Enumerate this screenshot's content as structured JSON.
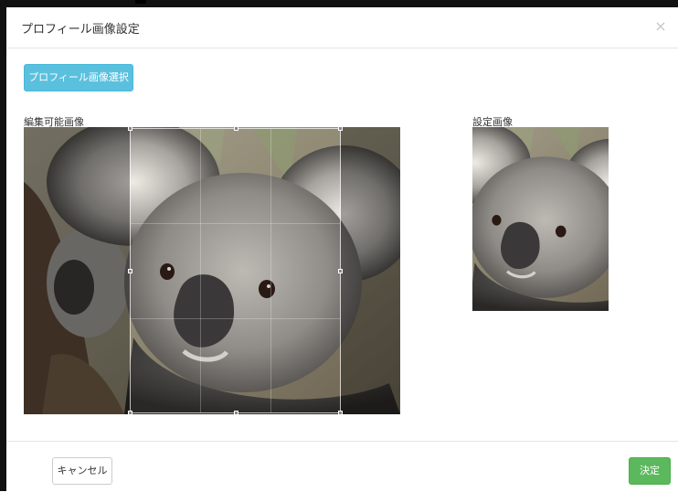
{
  "modal": {
    "title": "プロフィール画像設定",
    "close_glyph": "×"
  },
  "toolbar": {
    "select_image_label": "プロフィール画像選択"
  },
  "editor": {
    "label": "編集可能画像",
    "image_subject": "koala-photo"
  },
  "preview": {
    "label": "設定画像",
    "image_subject": "koala-photo-cropped"
  },
  "footer": {
    "cancel_label": "キャンセル",
    "ok_label": "決定"
  },
  "colors": {
    "info_button": "#5bc0de",
    "success_button": "#5cb85c",
    "border": "#e5e5e5"
  },
  "icons": {
    "close": "close-icon"
  }
}
